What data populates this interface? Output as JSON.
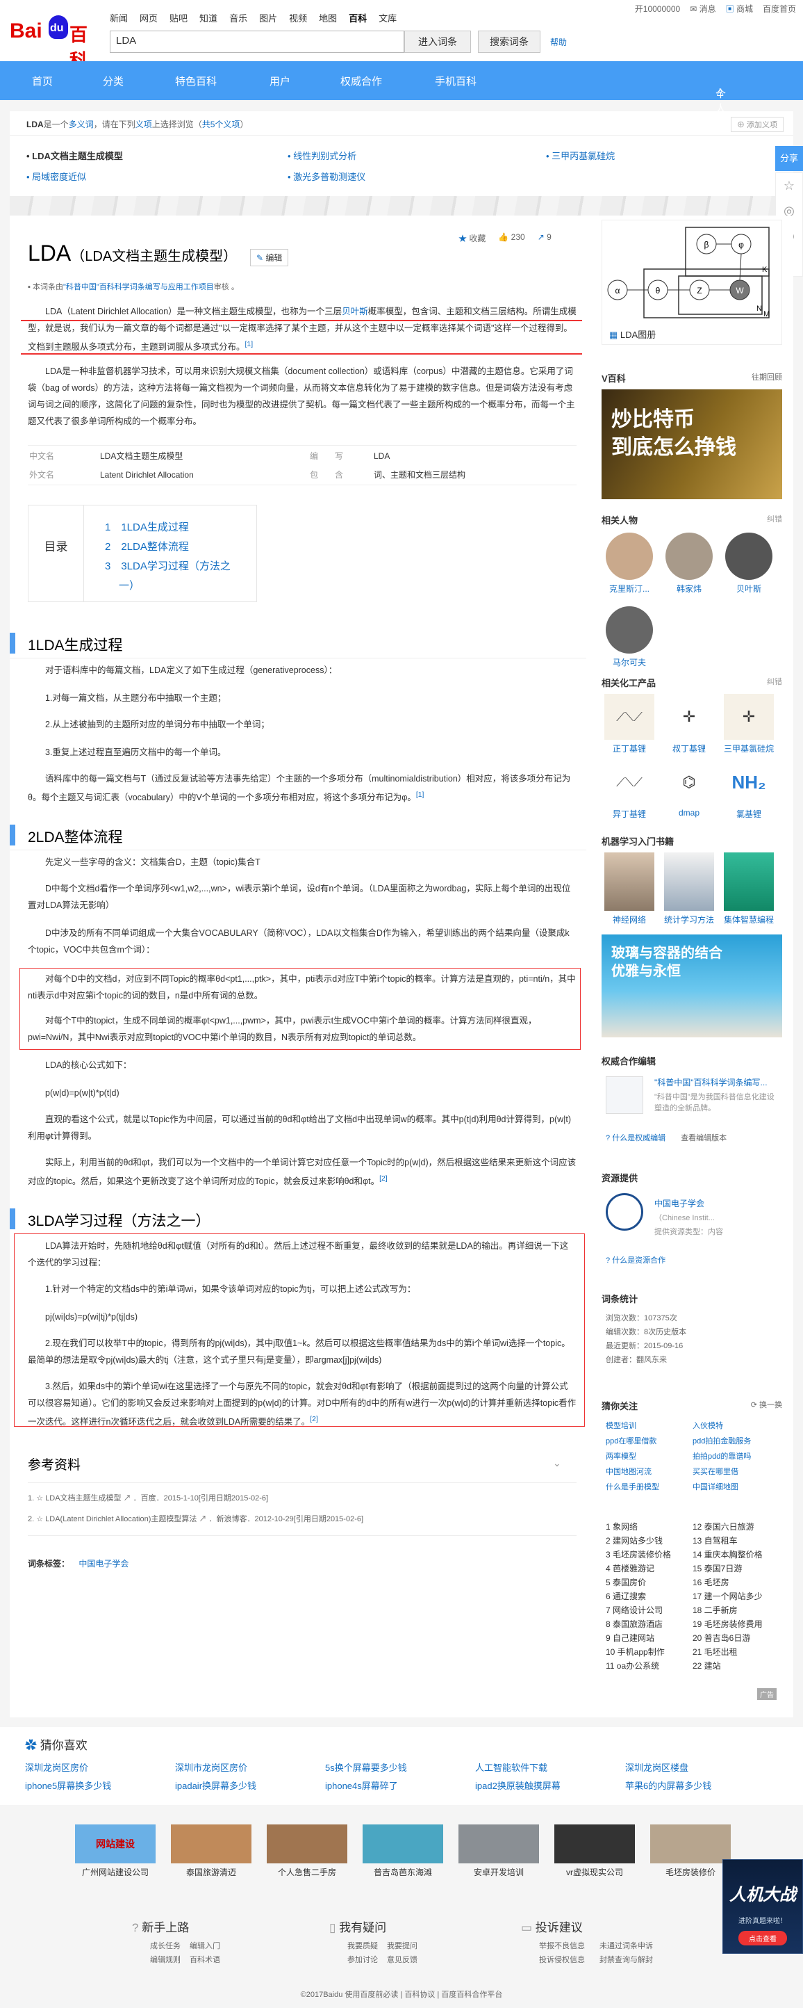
{
  "header": {
    "logo_text_bai": "Bai",
    "logo_text_du": "du",
    "logo_text_baike": "百科",
    "nav": [
      "新闻",
      "网页",
      "贴吧",
      "知道",
      "音乐",
      "图片",
      "视频",
      "地图",
      "百科",
      "文库"
    ],
    "search_value": "LDA",
    "enter_btn": "进入词条",
    "search_btn": "搜索词条",
    "help": "帮助",
    "top_links": [
      "开10000000",
      "消息",
      "商城",
      "百度首页"
    ]
  },
  "menu": [
    "首页",
    "分类",
    "特色百科",
    "用户",
    "权威合作",
    "手机百科",
    "个人中心"
  ],
  "polysemy": {
    "prefix_a": "LDA",
    "prefix_b": "是一个",
    "prefix_link": "多义词",
    "prefix_c": "，请在下列",
    "prefix_link2": "义项",
    "prefix_d": "上选择浏览（",
    "prefix_link3": "共5个义项",
    "prefix_e": "）",
    "add": "添加义项",
    "items": [
      "LDA文档主题生成模型",
      "线性判别式分析",
      "三甲丙基氯硅烷",
      "局域密度近似",
      "激光多普勒测速仪"
    ]
  },
  "share": "分享",
  "title": {
    "main": "LDA",
    "sub": "（LDA文档主题生成模型）",
    "edit": "编辑"
  },
  "stats": {
    "collect": "收藏",
    "like": "230",
    "share": "9"
  },
  "review": {
    "prefix": "本词条由",
    "link": "\"科普中国\"百科科学词条编写与应用工作项目",
    "suffix": "审核 。"
  },
  "intro1": {
    "a": "LDA（Latent Dirichlet Allocation）是一种文档主题生成模型，也称为一个三层",
    "link": "贝叶斯",
    "b": "概率模型，包含词、主题和文档三层结构。所谓生成模型，就是说，我们认为一篇文章的每个词都是通过\"以一定概率选择了某个主题，并从这个主题中以一定概率选择某个词语\"这样一个过程得到。文档到主题服从多项式分布，主题到词服从多项式分布。",
    "ref": "[1]"
  },
  "intro2": "LDA是一种非监督机器学习技术，可以用来识别大规模文档集（document collection）或语料库（corpus）中潜藏的主题信息。它采用了词袋（bag of words）的方法，这种方法将每一篇文档视为一个词频向量，从而将文本信息转化为了易于建模的数字信息。但是词袋方法没有考虑词与词之间的顺序，这简化了问题的复杂性，同时也为模型的改进提供了契机。每一篇文档代表了一些主题所构成的一个概率分布，而每一个主题又代表了很多单词所构成的一个概率分布。",
  "basic": {
    "r1": [
      "中文名",
      "LDA文档主题生成模型",
      "编　　写",
      "LDA"
    ],
    "r2": [
      "外文名",
      "Latent Dirichlet Allocation",
      "包　　含",
      "词、主题和文档三层结构"
    ]
  },
  "toc": {
    "label": "目录",
    "items": [
      "1　1LDA生成过程",
      "2　2LDA整体流程",
      "3　3LDA学习过程（方法之",
      "一）"
    ]
  },
  "sec1": {
    "title": "1LDA生成过程",
    "p1": "对于语料库中的每篇文档，LDA定义了如下生成过程（generativeprocess）：",
    "p2": "1.对每一篇文档，从主题分布中抽取一个主题；",
    "p3": "2.从上述被抽到的主题所对应的单词分布中抽取一个单词；",
    "p4": "3.重复上述过程直至遍历文档中的每一个单词。",
    "p5": "语料库中的每一篇文档与T（通过反复试验等方法事先给定）个主题的一个多项分布（multinomialdistribution）相对应，将该多项分布记为θ。每个主题又与词汇表（vocabulary）中的V个单词的一个多项分布相对应，将这个多项分布记为φ。",
    "ref": "[1]"
  },
  "sec2": {
    "title": "2LDA整体流程",
    "p1": "先定义一些字母的含义：文档集合D，主题（topic)集合T",
    "p2": "D中每个文档d看作一个单词序列<w1,w2,...,wn>，wi表示第i个单词，设d有n个单词。（LDA里面称之为wordbag，实际上每个单词的出现位置对LDA算法无影响）",
    "p3": "D中涉及的所有不同单词组成一个大集合VOCABULARY（简称VOC），LDA以文档集合D作为输入，希望训练出的两个结果向量（设聚成k个topic，VOC中共包含m个词）：",
    "p4": "对每个D中的文档d，对应到不同Topic的概率θd<pt1,...,ptk>，其中，pti表示d对应T中第i个topic的概率。计算方法是直观的，pti=nti/n，其中nti表示d中对应第i个topic的词的数目，n是d中所有词的总数。",
    "p5": "对每个T中的topict，生成不同单词的概率φt<pw1,...,pwm>，其中，pwi表示t生成VOC中第i个单词的概率。计算方法同样很直观，pwi=Nwi/N，其中Nwi表示对应到topict的VOC中第i个单词的数目，N表示所有对应到topict的单词总数。",
    "p6": "LDA的核心公式如下：",
    "p7": "p(w|d)=p(w|t)*p(t|d)",
    "p8": "直观的看这个公式，就是以Topic作为中间层，可以通过当前的θd和φt给出了文档d中出现单词w的概率。其中p(t|d)利用θd计算得到，p(w|t)利用φt计算得到。",
    "p9": "实际上，利用当前的θd和φt，我们可以为一个文档中的一个单词计算它对应任意一个Topic时的p(w|d)，然后根据这些结果来更新这个词应该对应的topic。然后，如果这个更新改变了这个单词所对应的Topic，就会反过来影响θd和φt。",
    "ref": "[2]"
  },
  "sec3": {
    "title": "3LDA学习过程（方法之一）",
    "p1": "LDA算法开始时，先随机地给θd和φt赋值（对所有的d和t）。然后上述过程不断重复，最终收敛到的结果就是LDA的输出。再详细说一下这个迭代的学习过程：",
    "p2": "1.针对一个特定的文档ds中的第i单词wi，如果令该单词对应的topic为tj，可以把上述公式改写为：",
    "p3": "pj(wi|ds)=p(wi|tj)*p(tj|ds)",
    "p4": "2.现在我们可以枚举T中的topic，得到所有的pj(wi|ds)，其中j取值1~k。然后可以根据这些概率值结果为ds中的第i个单词wi选择一个topic。最简单的想法是取令pj(wi|ds)最大的tj（注意，这个式子里只有j是变量），即argmax[j]pj(wi|ds)",
    "p5": "3.然后，如果ds中的第i个单词wi在这里选择了一个与原先不同的topic，就会对θd和φt有影响了（根据前面提到过的这两个向量的计算公式可以很容易知道）。它们的影响又会反过来影响对上面提到的p(w|d)的计算。对D中所有的d中的所有w进行一次p(w|d)的计算并重新选择topic看作一次迭代。这样进行n次循环迭代之后，就会收敛到LDA所需要的结果了。",
    "ref": "[2]"
  },
  "refs": {
    "title": "参考资料",
    "r1": "1.  ☆  LDA文档主题生成模型  ↗  ．百度．2015-1-10[引用日期2015-02-6]",
    "r2": "2.  ☆  LDA(Latent Dirichlet Allocation)主题模型算法  ↗  ．新浪博客．2012-10-29[引用日期2015-02-6]"
  },
  "tags": {
    "label": "词条标签：",
    "value": "中国电子学会"
  },
  "side": {
    "diagram_caption": "LDA图册",
    "diagram_nodes": [
      "α",
      "θ",
      "Z",
      "W",
      "β",
      "φ",
      "K",
      "N",
      "M"
    ],
    "vbaike": "V百科",
    "vbaike_link": "往期回顾",
    "vbaike_ad": "炒比特币\n到底怎么挣钱",
    "related_people": "相关人物",
    "report": "纠错",
    "people": [
      "克里斯汀...",
      "韩家炜",
      "贝叶斯",
      "马尔可夫"
    ],
    "chem_title": "相关化工产品",
    "chem": [
      "正丁基锂",
      "叔丁基锂",
      "三甲基氯硅烷",
      "异丁基锂",
      "dmap",
      "氯基锂"
    ],
    "books_title": "机器学习入门书籍",
    "books": [
      "神经网络",
      "统计学习方法",
      "集体智慧编程"
    ],
    "glass_ad": "玻璃与容器的结合\n优雅与永恒",
    "auth_title": "权威合作编辑",
    "auth_name": "\"科普中国\"百科科学词条编写...",
    "auth_desc": "\"科普中国\"是为我国科普信息化建设塑造的全新品牌。",
    "auth_links": [
      "什么是权威编辑",
      "查看编辑版本"
    ],
    "res_title": "资源提供",
    "res_name": "中国电子学会",
    "res_en": "（Chinese Instit...",
    "res_desc": "提供资源类型：内容",
    "res_link": "什么是资源合作",
    "stat_title": "词条统计",
    "stat": [
      "浏览次数：107375次",
      "编辑次数：8次历史版本",
      "最近更新：2015-09-16",
      "创建者：翻风东来"
    ],
    "hot_title": "猜你关注",
    "hot_change": "换一换",
    "hot": [
      "模型培训",
      "入伙模特",
      "ppd在哪里借款",
      "pdd拍拍金融服务",
      "两率模型",
      "拍拍pdd的靠谱吗",
      "中国地图河流",
      "买买在哪里借",
      "什么是手册模型",
      "中国详细地图"
    ],
    "rank": [
      "1 象网络",
      "2 建网站多少钱",
      "3 毛坯房装修价格",
      "4 芭楼雅游记",
      "5 泰国房价",
      "6 通辽搜索",
      "7 网络设计公司",
      "8 泰国旅游酒店",
      "9 自己建网站",
      "10 手机app制作",
      "11 oa办公系统",
      "12 泰国六日旅游",
      "13 自驾租车",
      "14 重庆本胸整价格",
      "15 泰国7日游",
      "16 毛坯房",
      "17 建一个网站多少",
      "18 二手新房",
      "19 毛坯房装修费用",
      "20 普吉岛6日游",
      "21 毛坯出租",
      "22 建站"
    ],
    "rank_ad": "广告"
  },
  "guess": {
    "title": "猜你喜欢",
    "row1": [
      "深圳龙岗区房价",
      "深圳市龙岗区房价",
      "5s换个屏幕要多少钱",
      "人工智能软件下载",
      "深圳龙岗区楼盘"
    ],
    "row2": [
      "iphone5屏幕换多少钱",
      "ipadair换屏幕多少钱",
      "iphone4s屏幕碎了",
      "ipad2换原装触摸屏幕",
      "苹果6的内屏幕多少钱"
    ],
    "pics": [
      "广州网站建设公司",
      "泰国旅游清迈",
      "个人急售二手房",
      "普吉岛芭东海滩",
      "安卓开发培训",
      "vr虚拟现实公司",
      "毛坯房装修价"
    ],
    "pic_title": "网站建设"
  },
  "help": {
    "c1": {
      "title": "新手上路",
      "links": [
        "成长任务",
        "编辑入门",
        "编辑规则",
        "百科术语"
      ]
    },
    "c2": {
      "title": "我有疑问",
      "links": [
        "我要质疑",
        "我要提问",
        "参加讨论",
        "意见反馈"
      ]
    },
    "c3": {
      "title": "投诉建议",
      "links": [
        "举报不良信息",
        "未通过词条申诉",
        "投诉侵权信息",
        "封禁查询与解封"
      ]
    }
  },
  "copyright": "©2017Baidu 使用百度前必读 | 百科协议 | 百度百科合作平台",
  "float_ad": {
    "title": "人机大战",
    "sub": "进阶真题来啦！",
    "btn": "点击查看"
  },
  "colors": {
    "brand_blue": "#459df5",
    "link": "#136ec2",
    "red_box": "#ee3333"
  }
}
